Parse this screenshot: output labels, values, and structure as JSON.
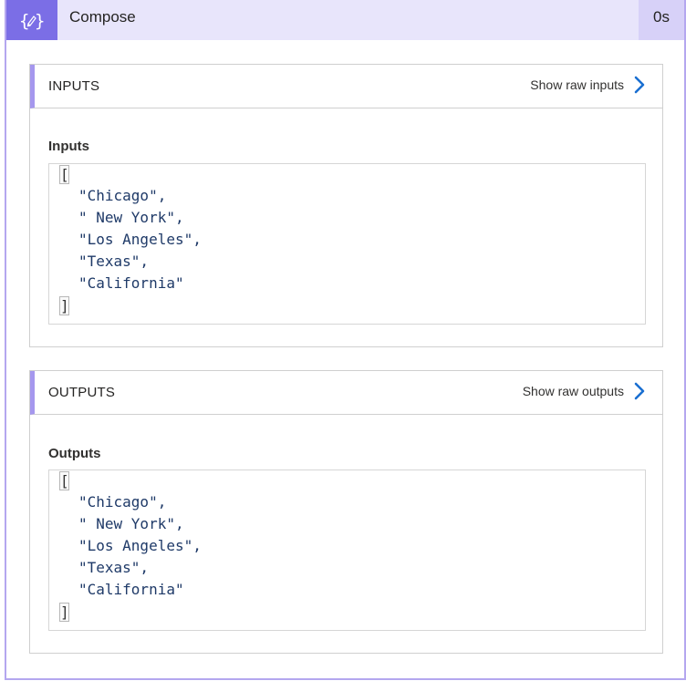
{
  "header": {
    "title": "Compose",
    "duration": "0s",
    "icon": "compose-braces-icon",
    "accent": "#7b6ee6",
    "bg": "#e8e5fb"
  },
  "inputs_section": {
    "label": "INPUTS",
    "raw_link": "Show raw inputs",
    "field_label": "Inputs",
    "open_bracket": "[",
    "close_bracket": "]",
    "lines": [
      "\"Chicago\",",
      "\" New York\",",
      "\"Los Angeles\",",
      "\"Texas\",",
      "\"California\""
    ]
  },
  "outputs_section": {
    "label": "OUTPUTS",
    "raw_link": "Show raw outputs",
    "field_label": "Outputs",
    "open_bracket": "[",
    "close_bracket": "]",
    "lines": [
      "\"Chicago\",",
      "\" New York\",",
      "\"Los Angeles\",",
      "\"Texas\",",
      "\"California\""
    ]
  }
}
